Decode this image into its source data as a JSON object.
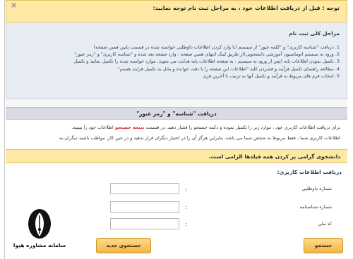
{
  "notice": {
    "title": "توجه : قبل از دریافت اطلاعات خود ، به مراحل ثبت نام توجه نمایید:"
  },
  "steps": {
    "heading": "مراحل کلی ثبت نام",
    "items": [
      "1. دریافت \"شناسه کاربری\" و \"کلمه عبور\" از سیستم (با وارد کردن اطلاعات داوطلبی خواسته شده در قسمت پایین همین صفحه)",
      "2. ورود به سیستم  اتوماسیون آموزشی دانشجویی(از طریق لینک انتهای همین صفحه ، وارد صفحه بعد شده و \"شناسه کاربری\" و \"رمز عبور\"",
      "3. تکمیل نمودن اطلاعات پایه (پس از ورود به سیستم ، به صفحه اطلاعات پایه هدایت می شوید. موارد خواسته شده را تکمیل  نمایید و تکمیل",
      "4. مطالعه راهنمای تکمیل فرآیند و فشردن کلید \"اطلاعات این صفحه را با دقت خوانده و مایل به تکمیل فرایند هستم\"",
      "5. انتخاب فرم های مربوط به فرآیند و تکمیل آنها به ترتیب  تا آخرین فرم"
    ]
  },
  "receive": {
    "heading": "دریافت \"شناسه\" و \"رمز عبور\"",
    "line1_pre": "برای دریافت اطلاعات کاربری خود ، موارد زیر را تکمیل نموده و دکمه جستجو را فشار دهید.  در قسمت ",
    "line1_hl": "نتیجه جستجو",
    "line1_post": " اطلاعات خود را ببینید.",
    "line2": "اطلاعات کاربری شما ، فقط مربوط به شخص شما می باشد، بنابراین هرگز آن را در اختیار دیگران قرار ندهید و در حین کار، مواظب باشید دیگران به"
  },
  "warning": "دانشجوی گرامی پر کردن همه فیلدها الزامی است.",
  "form": {
    "title": "دریافت اطلاعات کاربری:",
    "fields": [
      {
        "label": "شماره داوطلبی",
        "value": ""
      },
      {
        "label": "شماره شناسنامه",
        "value": ""
      },
      {
        "label": "کد ملی",
        "value": ""
      }
    ],
    "colon": ":",
    "search_label": "جستجو",
    "new_search_label": "جستجوی جدید"
  },
  "logo": {
    "brand": "سامانه مشاوره هپوا",
    "icon": "quill-pen-icon"
  },
  "colors": {
    "notice_bg": "#fde9a3",
    "panel_bg": "#e8edf4",
    "highlight": "#cc2a2a",
    "button": "#f2b648"
  }
}
